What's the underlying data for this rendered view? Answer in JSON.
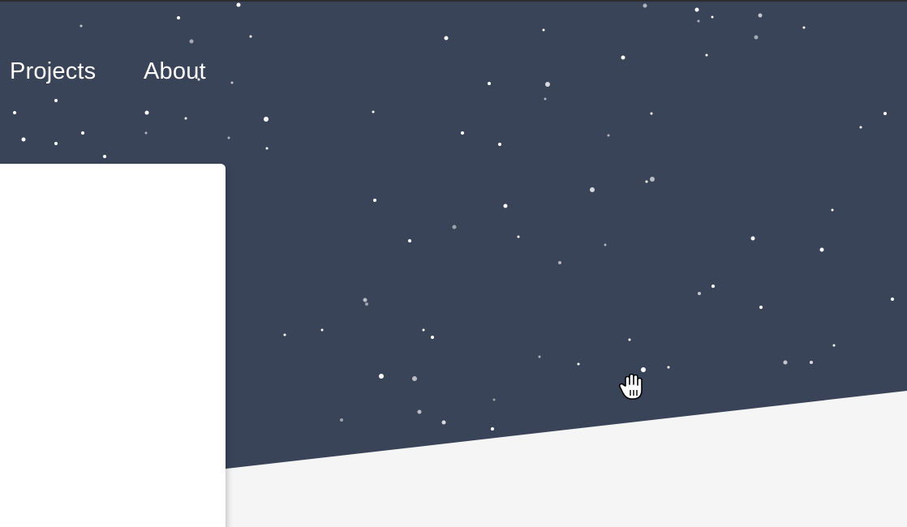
{
  "nav": {
    "items": [
      {
        "label": "Projects"
      },
      {
        "label": "About"
      }
    ]
  },
  "colors": {
    "hero_background": "#3a4459",
    "page_background": "#f5f5f5",
    "card_background": "#ffffff",
    "star": "#ffffff"
  },
  "icons": {
    "cursor": "grab-hand-cursor-icon"
  }
}
